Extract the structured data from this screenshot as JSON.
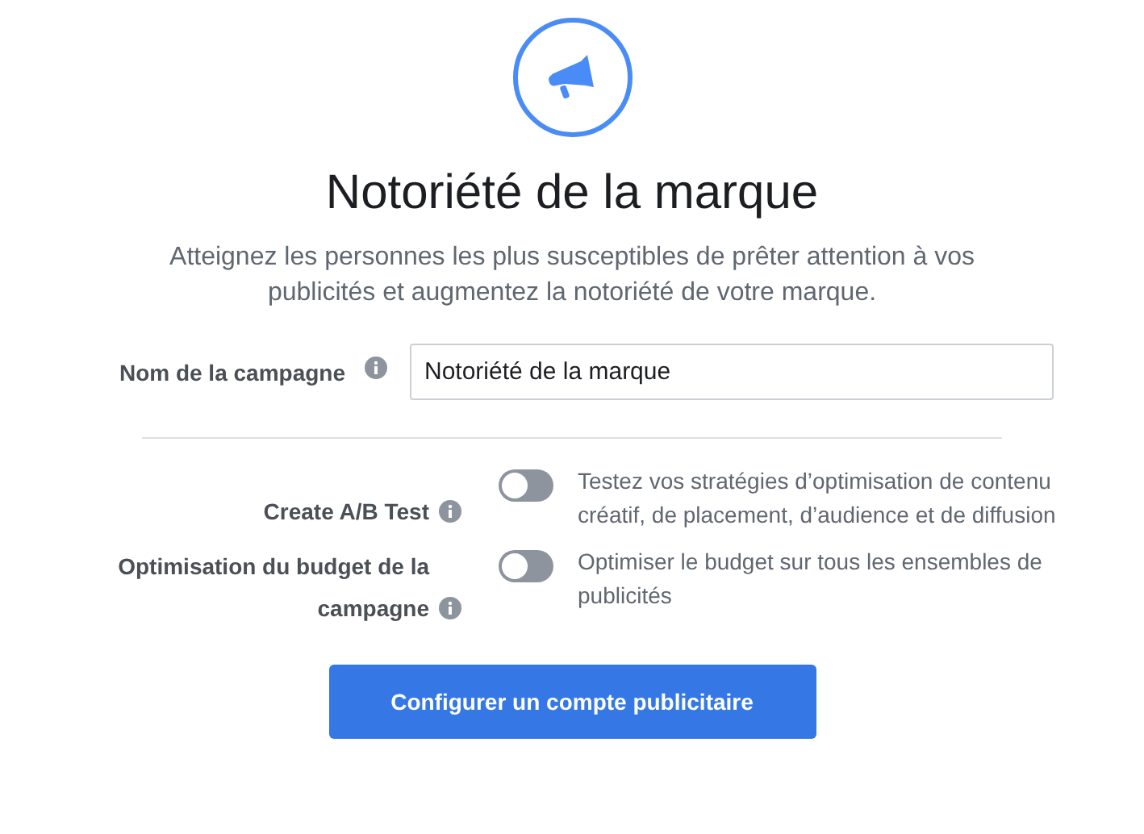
{
  "title": "Notoriété de la marque",
  "description": "Atteignez les personnes les plus susceptibles de prêter attention à vos publicités et augmentez la notoriété de votre marque.",
  "campaign_name": {
    "label": "Nom de la campagne",
    "value": "Notoriété de la marque"
  },
  "toggles": [
    {
      "label": "Create A/B Test",
      "on": false,
      "description": "Testez vos stratégies d’optimisation de contenu créatif, de placement, d’audience et de diffusion"
    },
    {
      "label": "Optimisation du budget de la campagne",
      "on": false,
      "description": "Optimiser le budget sur tous les ensembles de publicités"
    }
  ],
  "button": "Configurer un compte publicitaire"
}
